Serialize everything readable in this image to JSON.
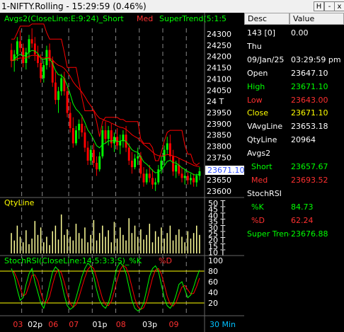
{
  "window": {
    "title": "1-NIFTY.Rolling - 15:29:59 (0.46%)",
    "btn_help": "H",
    "btn_min": "-",
    "btn_close": "x"
  },
  "colors": {
    "background": "#000000",
    "candle_up": "#00ff00",
    "candle_down": "#ff0000",
    "short_line": "#00ff00",
    "med_line": "#ff0000",
    "supertrend": "#ff0000",
    "axis_text": "#ffffff",
    "volume_bar": "#ffff99",
    "stoch_k": "#00ff00",
    "stoch_d": "#ff0000",
    "stoch_level": "#ffff00"
  },
  "chart": {
    "legend_prefix": "Avgs2(CloseLine:E:9:24)_Short",
    "legend_med": "Med",
    "legend_supertrend": "SuperTrend(5:1:5",
    "last_price_label": "23671.10",
    "volume_title": "QtyLine",
    "stoch_title": "StochRSI(CloseLine:14:5:3:3:S)_%K",
    "stoch_d_label": "%D",
    "timeframe": "30 Min",
    "price_ticks": [
      "24300",
      "24250",
      "24200",
      "24150",
      "24100",
      "24050",
      "24 T",
      "23950",
      "23900",
      "23850",
      "23800",
      "23750",
      "23700",
      "23650",
      "23600"
    ],
    "volume_ticks": [
      "50 T",
      "45 T",
      "40 T",
      "35 T",
      "30 T",
      "25 T",
      "20 T",
      "15 T",
      "10 T"
    ],
    "stoch_ticks": [
      "100",
      "80",
      "60",
      "40",
      "20"
    ],
    "date_labels": [
      "03",
      "02p",
      "06",
      "07",
      "01p",
      "08",
      "03p",
      "09"
    ]
  },
  "chart_data": {
    "type": "candlestick",
    "price_ylim": [
      23560,
      24330
    ],
    "volume_ylim": [
      0,
      55000
    ],
    "stoch_ylim": [
      0,
      100
    ],
    "candles": [
      [
        24230,
        24260,
        24150,
        24180
      ],
      [
        24180,
        24230,
        24130,
        24210
      ],
      [
        24210,
        24290,
        24180,
        24270
      ],
      [
        24270,
        24320,
        24220,
        24240
      ],
      [
        24240,
        24260,
        24150,
        24170
      ],
      [
        24170,
        24240,
        24140,
        24220
      ],
      [
        24220,
        24300,
        24190,
        24280
      ],
      [
        24280,
        24330,
        24240,
        24260
      ],
      [
        24260,
        24290,
        24180,
        24210
      ],
      [
        24210,
        24250,
        24150,
        24170
      ],
      [
        24170,
        24210,
        24080,
        24100
      ],
      [
        24100,
        24180,
        24080,
        24160
      ],
      [
        24160,
        24250,
        24140,
        24230
      ],
      [
        24230,
        24260,
        24150,
        24180
      ],
      [
        24180,
        24200,
        24060,
        24080
      ],
      [
        24080,
        24130,
        23980,
        24000
      ],
      [
        24000,
        24060,
        23940,
        24040
      ],
      [
        24040,
        24120,
        24020,
        24100
      ],
      [
        24100,
        24130,
        24020,
        24040
      ],
      [
        24040,
        24060,
        23920,
        23940
      ],
      [
        23940,
        23990,
        23850,
        23870
      ],
      [
        23870,
        23920,
        23780,
        23800
      ],
      [
        23800,
        23880,
        23790,
        23860
      ],
      [
        23860,
        23910,
        23820,
        23890
      ],
      [
        23890,
        23930,
        23830,
        23850
      ],
      [
        23850,
        23880,
        23760,
        23780
      ],
      [
        23780,
        23810,
        23700,
        23720
      ],
      [
        23720,
        23790,
        23700,
        23770
      ],
      [
        23770,
        23800,
        23690,
        23710
      ],
      [
        23710,
        23740,
        23650,
        23680
      ],
      [
        23680,
        23760,
        23670,
        23740
      ],
      [
        23740,
        23880,
        23730,
        23860
      ],
      [
        23860,
        23900,
        23800,
        23820
      ],
      [
        23820,
        23880,
        23790,
        23860
      ],
      [
        23860,
        23890,
        23780,
        23800
      ],
      [
        23800,
        23850,
        23760,
        23830
      ],
      [
        23830,
        23870,
        23770,
        23790
      ],
      [
        23790,
        23840,
        23750,
        23810
      ],
      [
        23810,
        23860,
        23780,
        23840
      ],
      [
        23840,
        23880,
        23760,
        23780
      ],
      [
        23780,
        23800,
        23700,
        23720
      ],
      [
        23720,
        23760,
        23660,
        23690
      ],
      [
        23690,
        23750,
        23680,
        23730
      ],
      [
        23730,
        23780,
        23700,
        23740
      ],
      [
        23740,
        23760,
        23640,
        23660
      ],
      [
        23660,
        23690,
        23600,
        23620
      ],
      [
        23620,
        23680,
        23610,
        23660
      ],
      [
        23660,
        23700,
        23620,
        23640
      ],
      [
        23640,
        23680,
        23590,
        23610
      ],
      [
        23610,
        23640,
        23580,
        23620
      ],
      [
        23620,
        23700,
        23610,
        23680
      ],
      [
        23680,
        23740,
        23660,
        23720
      ],
      [
        23720,
        23790,
        23700,
        23770
      ],
      [
        23770,
        23830,
        23750,
        23800
      ],
      [
        23800,
        23840,
        23720,
        23740
      ],
      [
        23740,
        23770,
        23650,
        23670
      ],
      [
        23670,
        23720,
        23640,
        23700
      ],
      [
        23700,
        23730,
        23650,
        23660
      ],
      [
        23660,
        23690,
        23620,
        23640
      ],
      [
        23640,
        23680,
        23610,
        23650
      ],
      [
        23650,
        23670,
        23610,
        23630
      ],
      [
        23630,
        23660,
        23610,
        23640
      ],
      [
        23640,
        23660,
        23600,
        23620
      ],
      [
        23620,
        23660,
        23600,
        23650
      ],
      [
        23650,
        23690,
        23630,
        23671
      ]
    ],
    "volume": [
      22,
      14,
      30,
      18,
      12,
      25,
      10,
      16,
      35,
      20,
      28,
      12,
      18,
      9,
      24,
      30,
      15,
      42,
      20,
      26,
      18,
      14,
      32,
      22,
      16,
      28,
      12,
      20,
      36,
      14,
      22,
      30,
      18,
      25,
      12,
      34,
      16,
      28,
      20,
      14,
      38,
      22,
      30,
      18,
      26,
      15,
      20,
      32,
      12,
      24,
      18,
      28,
      16,
      22,
      30,
      14,
      20,
      26,
      18,
      12,
      24,
      16,
      22,
      30,
      20
    ],
    "stoch_k": [
      85,
      70,
      45,
      25,
      30,
      55,
      75,
      85,
      60,
      40,
      20,
      10,
      30,
      55,
      78,
      88,
      82,
      60,
      35,
      15,
      8,
      12,
      30,
      50,
      70,
      85,
      95,
      90,
      70,
      45,
      25,
      15,
      10,
      20,
      40,
      65,
      88,
      96,
      90,
      75,
      50,
      25,
      10,
      5,
      8,
      20,
      45,
      70,
      85,
      90,
      80,
      55,
      30,
      15,
      10,
      18,
      35,
      55,
      60,
      45,
      30,
      35,
      50,
      68,
      82
    ],
    "stoch_d": [
      80,
      78,
      65,
      48,
      33,
      37,
      53,
      72,
      73,
      62,
      40,
      23,
      20,
      32,
      54,
      74,
      83,
      77,
      59,
      37,
      19,
      12,
      17,
      31,
      50,
      68,
      83,
      90,
      85,
      68,
      47,
      28,
      17,
      15,
      23,
      42,
      64,
      83,
      91,
      87,
      72,
      50,
      28,
      13,
      8,
      11,
      24,
      45,
      67,
      82,
      85,
      75,
      55,
      33,
      18,
      14,
      21,
      36,
      50,
      53,
      45,
      37,
      38,
      51,
      67
    ]
  },
  "panel": {
    "col_desc": "Desc",
    "col_value": "Value",
    "rows": [
      {
        "label": "143 [0]",
        "value": "0.00",
        "label_color": "#ffffff",
        "value_color": "#ffffff"
      },
      {
        "label": "Thu",
        "value": "",
        "label_color": "#ffffff",
        "value_color": "#ffffff"
      },
      {
        "label": "09/Jan/25",
        "value": "03:29:59 pm",
        "label_color": "#ffffff",
        "value_color": "#ffffff"
      },
      {
        "label": "Open",
        "value": "23647.10",
        "label_color": "#ffffff",
        "value_color": "#ffffff"
      },
      {
        "label": "High",
        "value": "23671.10",
        "label_color": "#00ff00",
        "value_color": "#00ff00"
      },
      {
        "label": "Low",
        "value": "23643.00",
        "label_color": "#ff3030",
        "value_color": "#ff3030"
      },
      {
        "label": "Close",
        "value": "23671.10",
        "label_color": "#ffff00",
        "value_color": "#ffff00"
      },
      {
        "label": "VAvgLine",
        "value": "23653.18",
        "label_color": "#ffffff",
        "value_color": "#ffffff"
      },
      {
        "label": "QtyLine",
        "value": "20964",
        "label_color": "#ffffff",
        "value_color": "#ffffff"
      },
      {
        "label": "Avgs2",
        "value": "",
        "label_color": "#ffffff",
        "value_color": "#ffffff"
      },
      {
        "label": "Short",
        "value": "23657.67",
        "label_color": "#00ff00",
        "value_color": "#00ff00",
        "indent": true
      },
      {
        "label": "Med",
        "value": "23693.52",
        "label_color": "#ff3030",
        "value_color": "#ff3030",
        "indent": true
      },
      {
        "label": "StochRSI",
        "value": "",
        "label_color": "#ffffff",
        "value_color": "#ffffff"
      },
      {
        "label": "%K",
        "value": "84.73",
        "label_color": "#00ff00",
        "value_color": "#00ff00",
        "indent": true
      },
      {
        "label": "%D",
        "value": "62.24",
        "label_color": "#ff3030",
        "value_color": "#ff3030",
        "indent": true
      },
      {
        "label": "Super Trend",
        "value": "23676.88",
        "label_color": "#00ff00",
        "value_color": "#00ff00"
      }
    ]
  }
}
